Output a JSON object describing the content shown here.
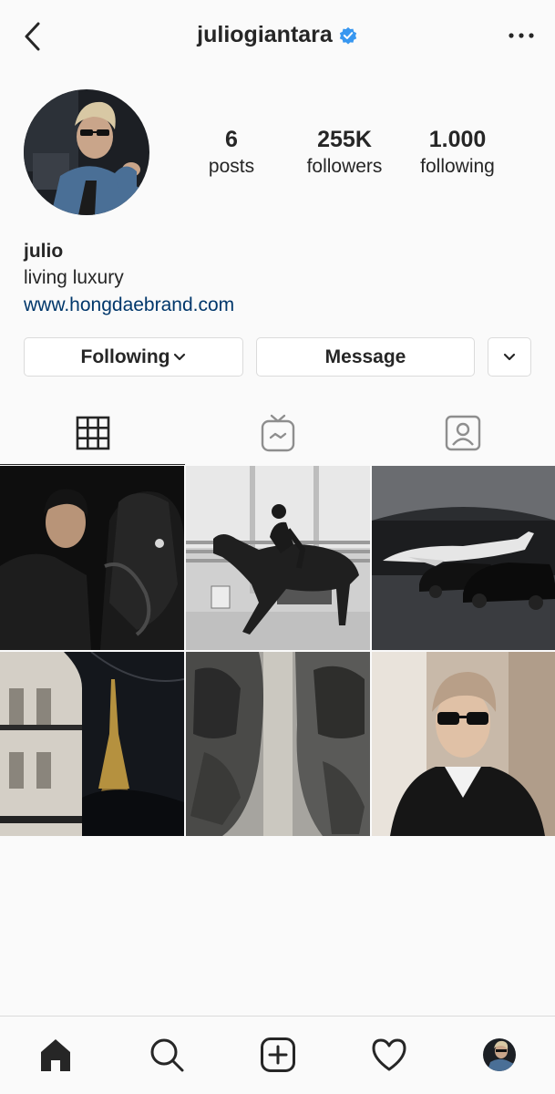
{
  "header": {
    "username": "juliogiantara",
    "verified": true,
    "back_icon": "chevron-left-icon",
    "more_icon": "more-horizontal-icon"
  },
  "profile": {
    "stats": [
      {
        "value": "6",
        "label": "posts"
      },
      {
        "value": "255K",
        "label": "followers"
      },
      {
        "value": "1.000",
        "label": "following"
      }
    ],
    "name": "julio",
    "bio": "living luxury",
    "website": "www.hongdaebrand.com"
  },
  "actions": {
    "following_label": "Following",
    "message_label": "Message"
  },
  "tabs": [
    {
      "icon": "grid-icon",
      "active": true
    },
    {
      "icon": "igtv-icon",
      "active": false
    },
    {
      "icon": "tagged-icon",
      "active": false
    }
  ],
  "posts": [
    {
      "subject": "man with black horse at night"
    },
    {
      "subject": "equestrian rider on horse"
    },
    {
      "subject": "private jet and black SUVs in hangar"
    },
    {
      "subject": "Eiffel Tower at night from balcony"
    },
    {
      "subject": "two matte sports cars parked"
    },
    {
      "subject": "man with sunglasses portrait"
    }
  ],
  "bottom_nav": [
    {
      "icon": "home-icon"
    },
    {
      "icon": "search-icon"
    },
    {
      "icon": "add-post-icon"
    },
    {
      "icon": "heart-icon"
    },
    {
      "icon": "profile-avatar-icon"
    }
  ],
  "colors": {
    "background": "#fafafa",
    "text": "#262626",
    "link": "#00376b",
    "verified": "#3897f0",
    "border": "#dbdbdb"
  }
}
